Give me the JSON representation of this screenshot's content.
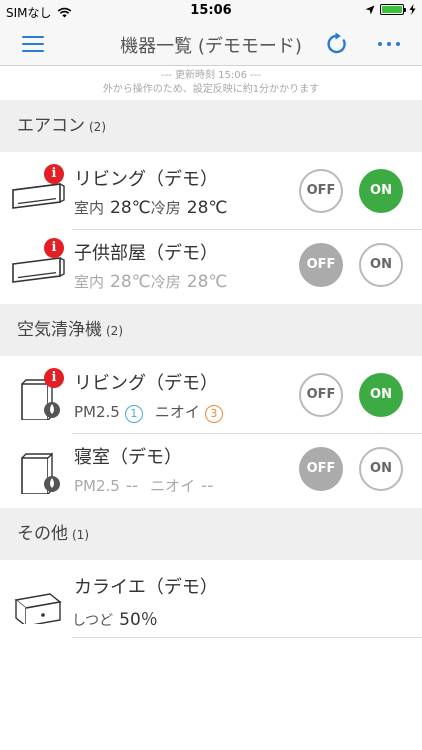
{
  "status_bar": {
    "carrier": "SIMなし",
    "time": "15:06"
  },
  "nav": {
    "title": "機器一覧 (デモモード)"
  },
  "update": {
    "time_line": "--- 更新時刻 15:06 ---",
    "note": "外から操作のため、設定反映に約1分かかります"
  },
  "colors": {
    "accent": "#2a7bd6",
    "on_green": "#3dab44",
    "disabled_grey": "#ababab",
    "badge_red": "#e31e24"
  },
  "sections": [
    {
      "title": "エアコン",
      "count": "(2)",
      "devices": [
        {
          "name": "リビング（デモ）",
          "temp_label": "室内",
          "temp": "28℃",
          "mode": "冷房",
          "set": "28℃",
          "off": "OFF",
          "on": "ON",
          "state": "on",
          "badge": "i",
          "icon": "air-conditioner-icon"
        },
        {
          "name": "子供部屋（デモ）",
          "temp_label": "室内",
          "temp": "28℃",
          "mode": "冷房",
          "set": "28℃",
          "off": "OFF",
          "on": "ON",
          "state": "off",
          "badge": "i",
          "icon": "air-conditioner-icon"
        }
      ]
    },
    {
      "title": "空気清浄機",
      "count": "(2)",
      "devices": [
        {
          "name": "リビング（デモ）",
          "pm_label": "PM2.5",
          "pm_level": "1",
          "odor_label": "ニオイ",
          "odor_level": "3",
          "off": "OFF",
          "on": "ON",
          "state": "on",
          "badge": "i",
          "icon": "air-purifier-icon"
        },
        {
          "name": "寝室（デモ）",
          "pm_label": "PM2.5",
          "pm_value": "--",
          "odor_label": "ニオイ",
          "odor_value": "--",
          "off": "OFF",
          "on": "ON",
          "state": "off",
          "icon": "air-purifier-icon"
        }
      ]
    },
    {
      "title": "その他",
      "count": "(1)",
      "devices": [
        {
          "name": "カライエ（デモ）",
          "humidity_label": "しつど",
          "humidity": "50％",
          "icon": "karaie-sensor-icon"
        }
      ]
    }
  ]
}
